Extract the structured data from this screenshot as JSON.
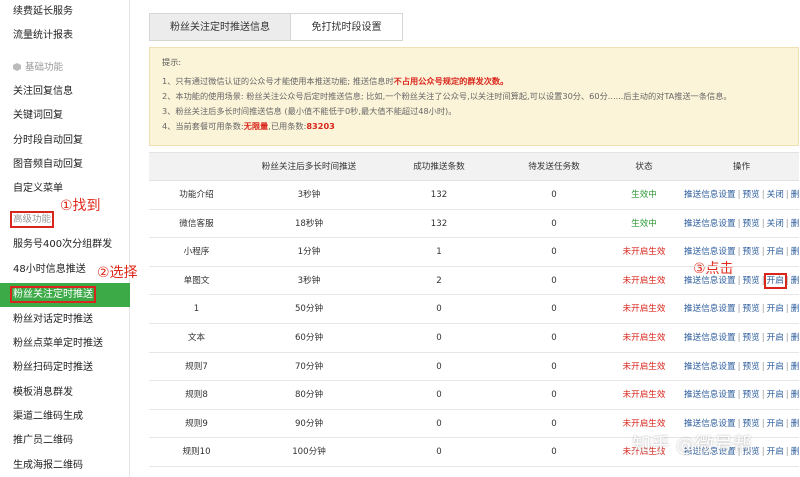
{
  "sidebar": {
    "items": [
      {
        "label": "续费延长服务",
        "type": "item"
      },
      {
        "label": "流量统计报表",
        "type": "item"
      },
      {
        "label": "基础功能",
        "type": "group"
      },
      {
        "label": "关注回复信息",
        "type": "item"
      },
      {
        "label": "关键词回复",
        "type": "item"
      },
      {
        "label": "分时段自动回复",
        "type": "item"
      },
      {
        "label": "图音频自动回复",
        "type": "item"
      },
      {
        "label": "自定义菜单",
        "type": "item"
      },
      {
        "label": "高级功能",
        "type": "group"
      },
      {
        "label": "服务号400次分组群发",
        "type": "item"
      },
      {
        "label": "48小时信息推送",
        "type": "item"
      },
      {
        "label": "粉丝关注定时推送",
        "type": "active"
      },
      {
        "label": "粉丝对话定时推送",
        "type": "item"
      },
      {
        "label": "粉丝点菜单定时推送",
        "type": "item"
      },
      {
        "label": "粉丝扫码定时推送",
        "type": "item"
      },
      {
        "label": "模板消息群发",
        "type": "item"
      },
      {
        "label": "渠道二维码生成",
        "type": "item"
      },
      {
        "label": "推广员二维码",
        "type": "item"
      },
      {
        "label": "生成海报二维码",
        "type": "item"
      }
    ]
  },
  "annotations": {
    "step1": "①找到",
    "step2": "②选择",
    "step3": "③点击"
  },
  "tabs": [
    {
      "label": "粉丝关注定时推送信息",
      "active": true
    },
    {
      "label": "免打扰时段设置",
      "active": false
    }
  ],
  "notice": {
    "title": "提示:",
    "line1_a": "1、只有通过微信认证的公众号才能使用本推送功能; 推送信息时",
    "line1_b": "不占用公众号规定的群发次数。",
    "line2": "2、本功能的使用场景: 粉丝关注公众号后定时推送信息; 比如,一个粉丝关注了公众号,以关注时间算起,可以设置30分、60分......后主动的对TA推送一条信息。",
    "line3": "3、粉丝关注后多长时间推送信息 (最小值不能低于0秒,最大值不能超过48小时)。",
    "line4_a": "4、当前套餐可用条数:",
    "line4_b": "无限量",
    "line4_c": ",已用条数:",
    "line4_d": "83203"
  },
  "table": {
    "headers": [
      "",
      "粉丝关注后多长时间推送",
      "成功推送条数",
      "待发送任务数",
      "状态",
      "操作"
    ],
    "rows": [
      {
        "name": "功能介绍",
        "delay": "3秒钟",
        "success": "132",
        "pending": "0",
        "status": "生效中",
        "status_on": true,
        "toggle": "关闭"
      },
      {
        "name": "微信客服",
        "delay": "18秒钟",
        "success": "132",
        "pending": "0",
        "status": "生效中",
        "status_on": true,
        "toggle": "关闭"
      },
      {
        "name": "小程序",
        "delay": "1分钟",
        "success": "1",
        "pending": "0",
        "status": "未开启生效",
        "status_on": false,
        "toggle": "开启"
      },
      {
        "name": "单图文",
        "delay": "3秒钟",
        "success": "2",
        "pending": "0",
        "status": "未开启生效",
        "status_on": false,
        "toggle": "开启"
      },
      {
        "name": "1",
        "delay": "50分钟",
        "success": "0",
        "pending": "0",
        "status": "未开启生效",
        "status_on": false,
        "toggle": "开启"
      },
      {
        "name": "文本",
        "delay": "60分钟",
        "success": "0",
        "pending": "0",
        "status": "未开启生效",
        "status_on": false,
        "toggle": "开启"
      },
      {
        "name": "规则7",
        "delay": "70分钟",
        "success": "0",
        "pending": "0",
        "status": "未开启生效",
        "status_on": false,
        "toggle": "开启"
      },
      {
        "name": "规则8",
        "delay": "80分钟",
        "success": "0",
        "pending": "0",
        "status": "未开启生效",
        "status_on": false,
        "toggle": "开启"
      },
      {
        "name": "规则9",
        "delay": "90分钟",
        "success": "0",
        "pending": "0",
        "status": "未开启生效",
        "status_on": false,
        "toggle": "开启"
      },
      {
        "name": "规则10",
        "delay": "100分钟",
        "success": "0",
        "pending": "0",
        "status": "未开启生效",
        "status_on": false,
        "toggle": "开启"
      }
    ],
    "ops": {
      "settings": "推送信息设置",
      "preview": "预览",
      "delete": "删除"
    }
  },
  "watermark": "知乎 @微号帮",
  "colors": {
    "active_green": "#3daa48",
    "annotation_red": "#d9261c",
    "link_blue": "#2b5c9c",
    "notice_bg": "#fcf4d9"
  }
}
